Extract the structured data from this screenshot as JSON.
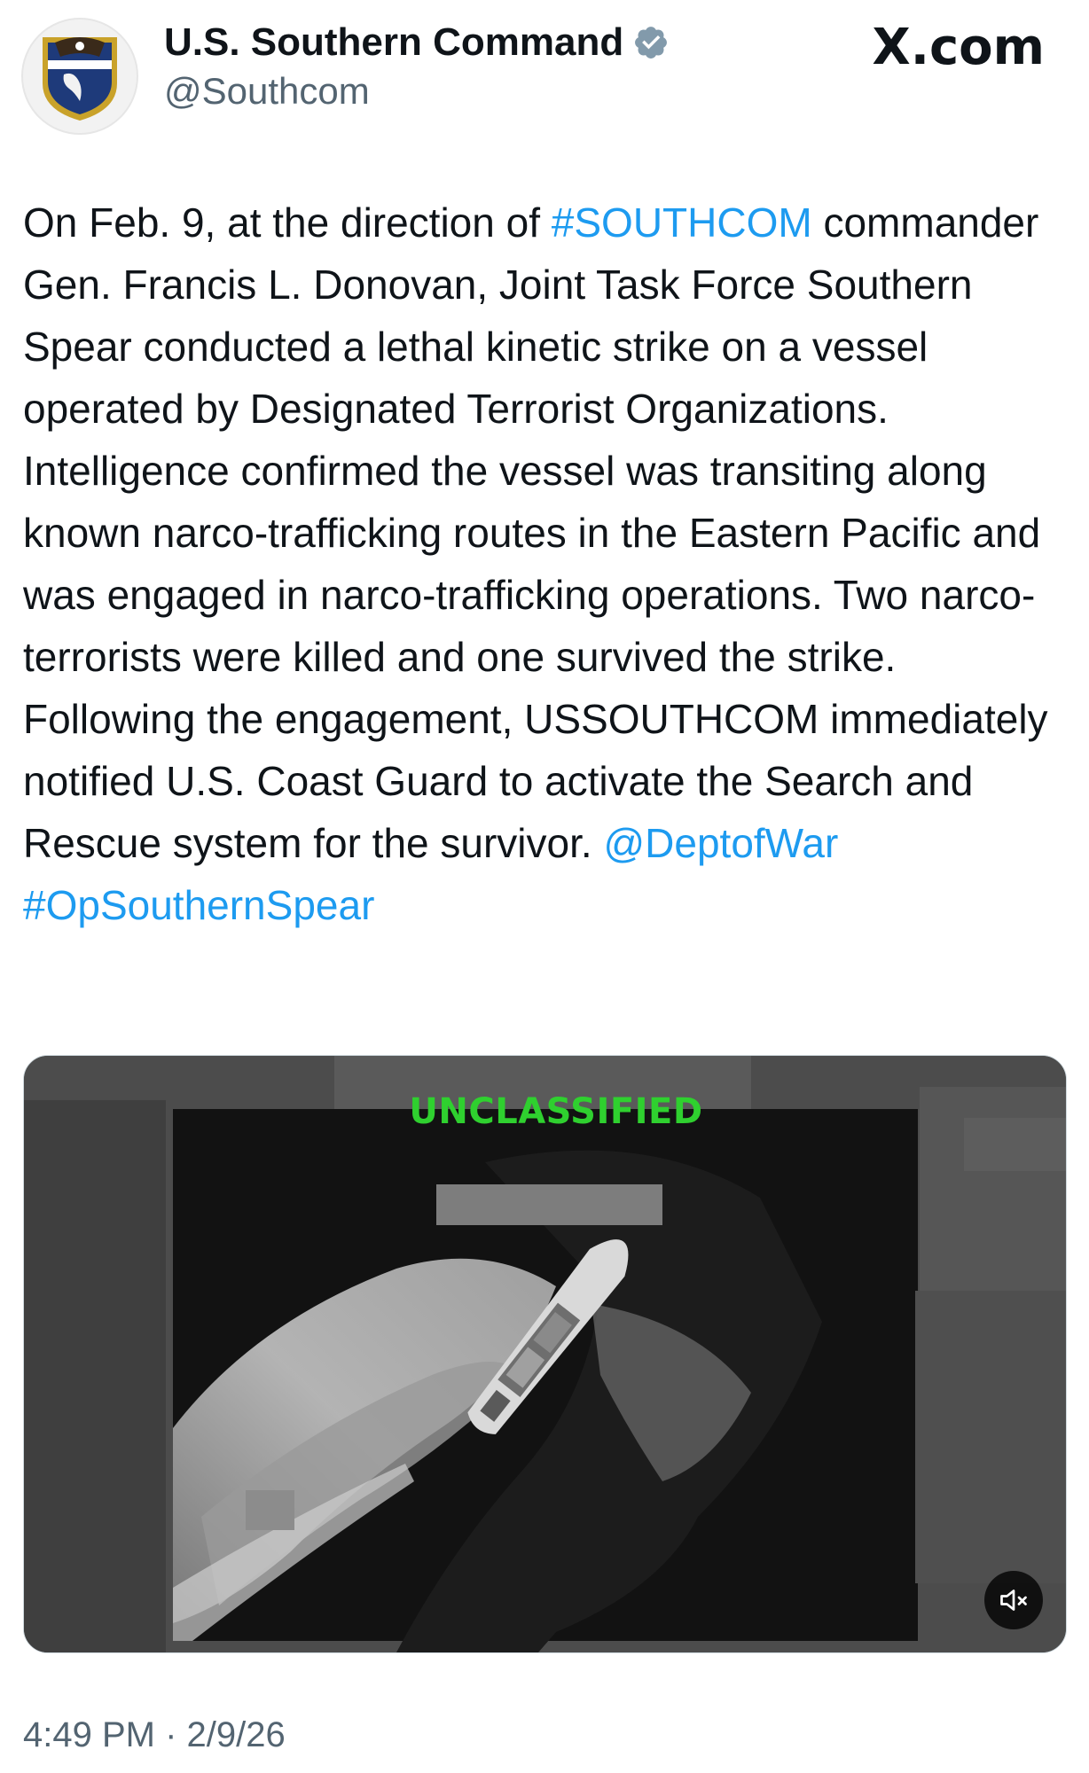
{
  "author": {
    "display_name": "U.S. Southern Command",
    "handle": "@Southcom",
    "verified_icon": "verified-badge-icon",
    "avatar_icon": "southcom-seal-icon"
  },
  "header": {
    "site_label": "X.com"
  },
  "tweet": {
    "text_before": "On Feb. 9, at the direction of ",
    "hashtag_southcom": "#SOUTHCOM",
    "text_main": " commander Gen. Francis L. Donovan, Joint Task Force Southern Spear conducted a lethal kinetic strike on a vessel operated by Designated Terrorist Organizations. Intelligence confirmed the vessel was transiting along known narco-trafficking routes in the Eastern Pacific and was engaged in narco-trafficking operations. Two narco-terrorists were killed and one survived the strike. Following the engagement, USSOUTHCOM immediately notified U.S. Coast Guard to activate the Search and Rescue system for the survivor. ",
    "mention_deptofwar": "@DeptofWar",
    "hashtag_op": "#OpSouthernSpear"
  },
  "media": {
    "classification_label": "UNCLASSIFIED",
    "mute_icon": "mute-speaker-icon"
  },
  "footer": {
    "timestamp": "4:49 PM · 2/9/26"
  },
  "colors": {
    "link": "#1d9bf0",
    "secondary_text": "#536471",
    "classification_green": "#2fd02f"
  }
}
